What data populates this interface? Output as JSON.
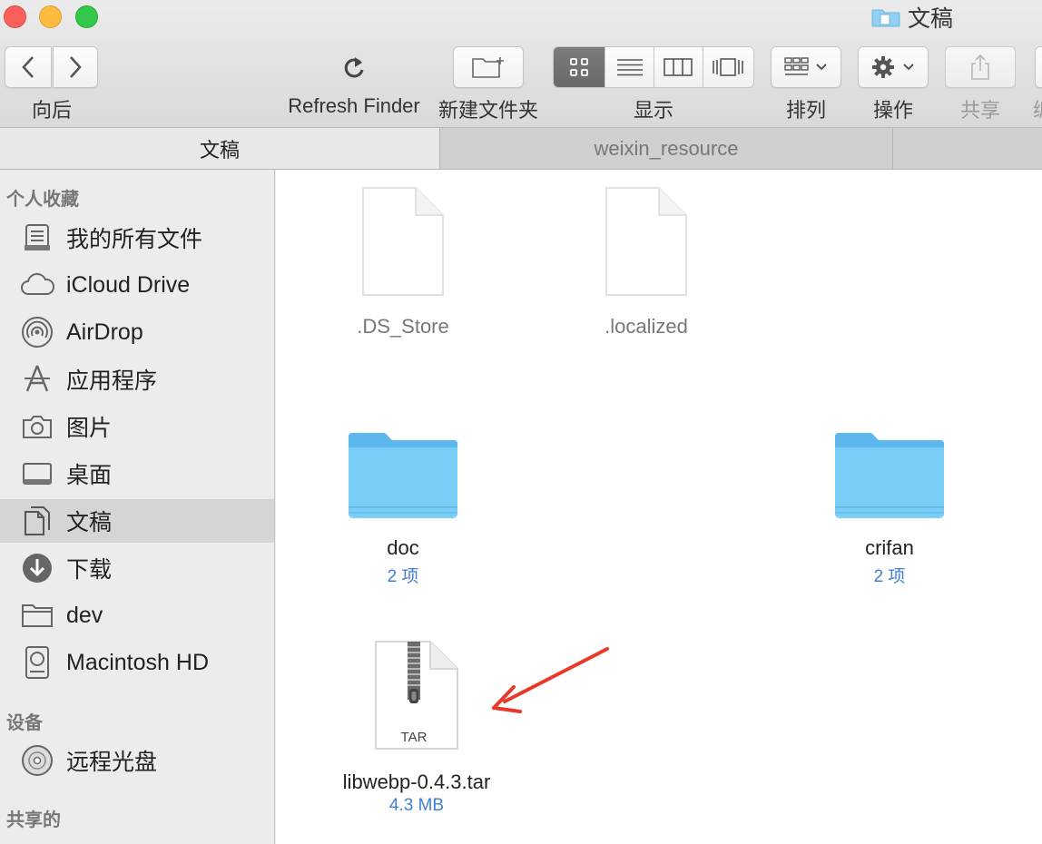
{
  "window": {
    "title": "文稿"
  },
  "toolbar": {
    "back_forward_label": "向后",
    "refresh_label": "Refresh Finder",
    "new_folder_label": "新建文件夹",
    "view_label": "显示",
    "arrange_label": "排列",
    "action_label": "操作",
    "share_label": "共享",
    "overflow_label": "编"
  },
  "tabs": [
    {
      "label": "文稿"
    },
    {
      "label": "weixin_resource"
    }
  ],
  "sidebar": {
    "favorites_title": "个人收藏",
    "favorites": [
      {
        "label": "我的所有文件",
        "icon": "all-files-icon"
      },
      {
        "label": "iCloud Drive",
        "icon": "cloud-icon"
      },
      {
        "label": "AirDrop",
        "icon": "airdrop-icon"
      },
      {
        "label": "应用程序",
        "icon": "applications-icon"
      },
      {
        "label": "图片",
        "icon": "camera-icon"
      },
      {
        "label": "桌面",
        "icon": "desktop-icon"
      },
      {
        "label": "文稿",
        "icon": "documents-icon",
        "selected": true
      },
      {
        "label": "下载",
        "icon": "download-icon"
      },
      {
        "label": "dev",
        "icon": "folder-icon"
      },
      {
        "label": "Macintosh HD",
        "icon": "hard-drive-icon"
      }
    ],
    "devices_title": "设备",
    "devices": [
      {
        "label": "远程光盘",
        "icon": "optical-disc-icon"
      }
    ],
    "shared_title": "共享的"
  },
  "files": [
    {
      "name": ".DS_Store",
      "kind": "document",
      "dimmed": true,
      "meta": ""
    },
    {
      "name": ".localized",
      "kind": "document",
      "dimmed": true,
      "meta": ""
    },
    {
      "name": "doc",
      "kind": "folder",
      "meta": "2 项"
    },
    {
      "name": "crifan",
      "kind": "folder",
      "meta": "2 项"
    },
    {
      "name": "libwebp-0.4.3.tar",
      "kind": "archive",
      "badge": "TAR",
      "meta": "4.3 MB"
    }
  ],
  "colors": {
    "accent_meta": "#3f7fd3",
    "folder_blue": "#6ec6f6",
    "annotation_arrow": "#e8392b"
  }
}
